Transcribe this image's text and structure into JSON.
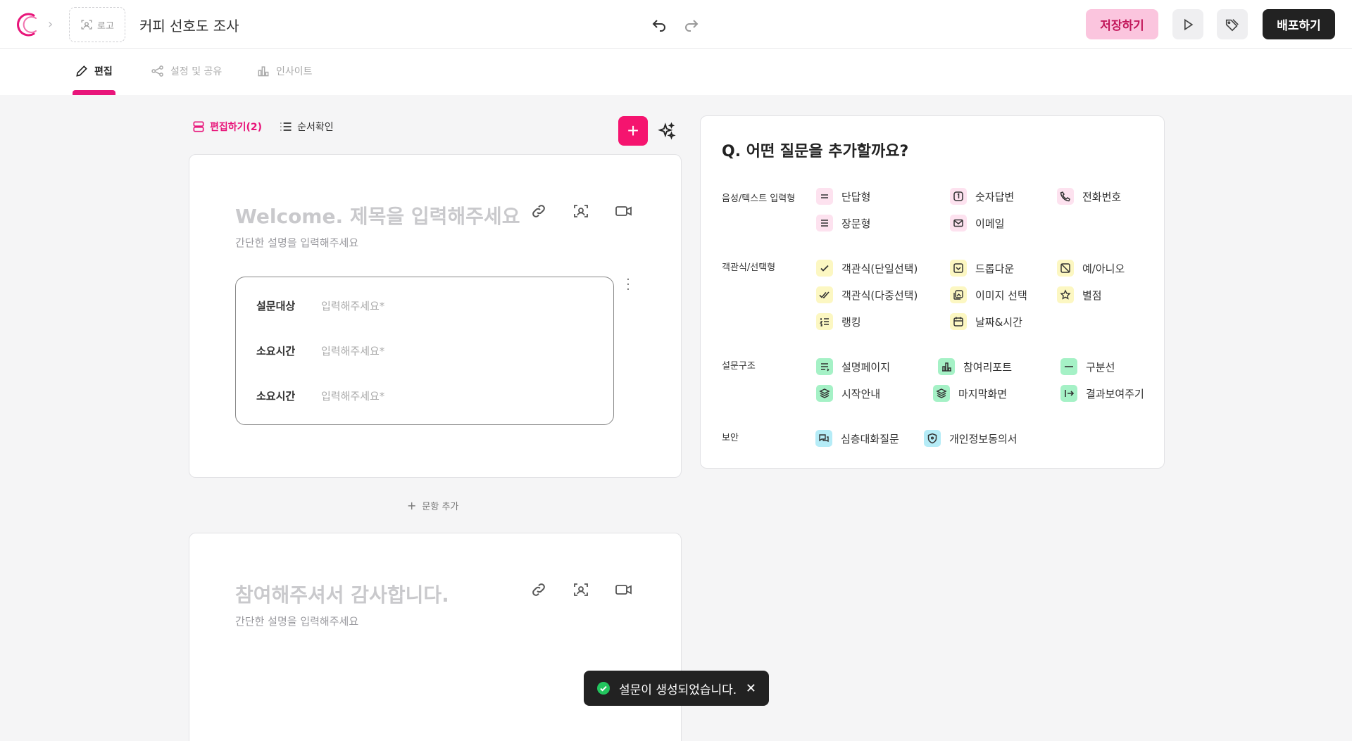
{
  "header": {
    "logo_label": "로고",
    "survey_title": "커피 선호도 조사",
    "save_label": "저장하기",
    "deploy_label": "배포하기"
  },
  "tabs": [
    {
      "label": "편집",
      "icon": "pencil-icon",
      "active": true
    },
    {
      "label": "설정 및 공유",
      "icon": "share-icon",
      "active": false
    },
    {
      "label": "인사이트",
      "icon": "bar-chart-icon",
      "active": false
    }
  ],
  "editor": {
    "toggle_edit": "편집하기(2)",
    "toggle_order": "순서확인",
    "add_item_label": "문항 추가"
  },
  "cards": [
    {
      "title": "Welcome. 제목을 입력해주세요",
      "description": "간단한 설명을 입력해주세요",
      "rows": [
        {
          "label": "설문대상",
          "placeholder": "입력해주세요*"
        },
        {
          "label": "소요시간",
          "placeholder": "입력해주세요*"
        },
        {
          "label": "소요시간",
          "placeholder": "입력해주세요*"
        }
      ]
    },
    {
      "title": "참여해주셔서 감사합니다.",
      "description": "간단한 설명을 입력해주세요"
    }
  ],
  "panel": {
    "title": "Q. 어떤 질문을 추가할까요?",
    "categories": [
      {
        "label": "음성/텍스트 입력형",
        "items": [
          "단답형",
          "숫자답변",
          "전화번호",
          "장문형",
          "이메일"
        ]
      },
      {
        "label": "객관식/선택형",
        "items": [
          "객관식(단일선택)",
          "드롭다운",
          "예/아니오",
          "객관식(다중선택)",
          "이미지 선택",
          "별점",
          "랭킹",
          "날짜&시간"
        ]
      },
      {
        "label": "설문구조",
        "items": [
          "설명페이지",
          "참여리포트",
          "구분선",
          "시작안내",
          "마지막화면",
          "결과보여주기"
        ]
      },
      {
        "label": "보안",
        "items": [
          "심층대화질문",
          "개인정보동의서"
        ]
      }
    ]
  },
  "toast": {
    "message": "설문이 생성되었습니다."
  },
  "colors": {
    "accent": "#f5146f",
    "save_bg": "#fbc5de",
    "dark": "#222222"
  }
}
